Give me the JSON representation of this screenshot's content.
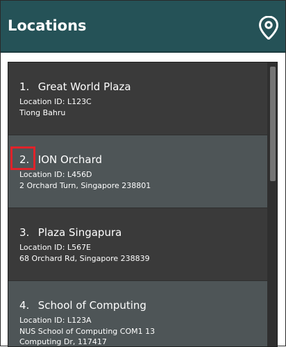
{
  "header": {
    "title": "Locations",
    "icon": "map-pin-icon"
  },
  "locations": [
    {
      "number": "1.",
      "name": "Great World Plaza",
      "location_id": "Location ID: L123C",
      "address_lines": [
        "Tiong Bahru"
      ]
    },
    {
      "number": "2.",
      "name": "ION Orchard",
      "location_id": "Location ID: L456D",
      "address_lines": [
        "2 Orchard Turn, Singapore 238801"
      ]
    },
    {
      "number": "3.",
      "name": "Plaza Singapura",
      "location_id": "Location ID: L567E",
      "address_lines": [
        "68 Orchard Rd, Singapore 238839"
      ]
    },
    {
      "number": "4.",
      "name": "School of Computing",
      "location_id": "Location ID: L123A",
      "address_lines": [
        "NUS School of Computing COM1 13",
        "Computing Dr, 117417"
      ]
    }
  ],
  "colors": {
    "header_bg": "#255257",
    "list_bg_dark": "#3a3a3a",
    "list_bg_light": "#4e5557",
    "highlight": "#e0232a"
  }
}
